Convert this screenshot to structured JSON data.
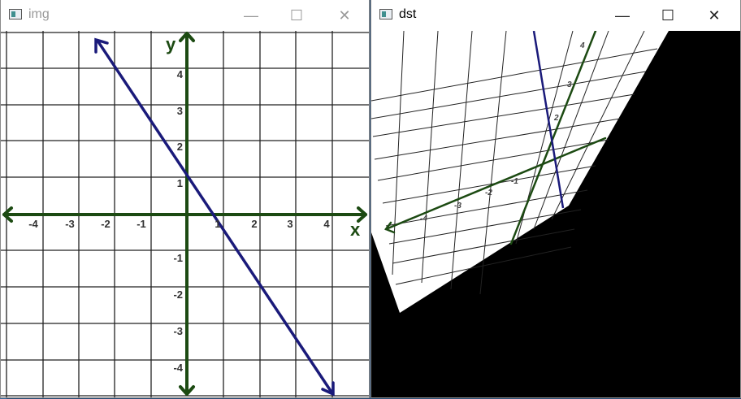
{
  "windows": [
    {
      "title": "img",
      "controls": {
        "minimize": "—",
        "maximize": "☐",
        "close": "✕"
      },
      "plot": {
        "x_ticks": [
          "-4",
          "-3",
          "-2",
          "-1",
          "1",
          "2",
          "3",
          "4"
        ],
        "y_ticks": [
          "4",
          "3",
          "2",
          "1",
          "-1",
          "-2",
          "-3",
          "-4"
        ],
        "x_label": "x",
        "y_label": "y",
        "axis_color": "#1c4a12",
        "line_color": "#1a1a7a"
      }
    },
    {
      "title": "dst",
      "controls": {
        "minimize": "—",
        "maximize": "☐",
        "close": "✕"
      },
      "warped": {
        "x_ticks": [
          "-4",
          "-3",
          "-2",
          "-1"
        ],
        "y_ticks": [
          "4",
          "3",
          "2"
        ],
        "background": "#000000"
      }
    }
  ]
}
